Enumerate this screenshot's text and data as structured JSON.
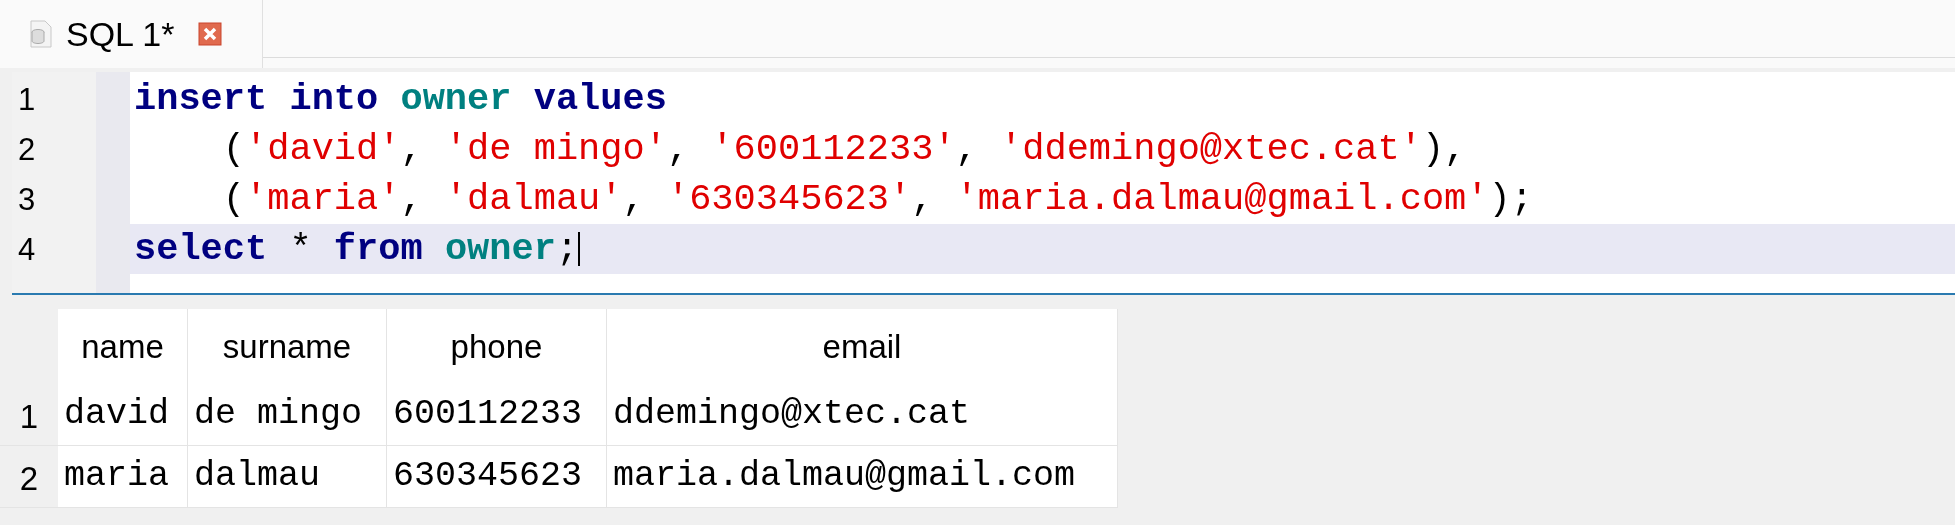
{
  "tab": {
    "label": "SQL 1*",
    "selected": true
  },
  "editor": {
    "lines": [
      {
        "number": "1",
        "current": false,
        "tokens": [
          {
            "text": "insert into ",
            "kind": "keyword"
          },
          {
            "text": "owner",
            "kind": "identifier"
          },
          {
            "text": " values",
            "kind": "keyword"
          }
        ]
      },
      {
        "number": "2",
        "current": false,
        "tokens": [
          {
            "text": "    (",
            "kind": "plain"
          },
          {
            "text": "'david'",
            "kind": "string"
          },
          {
            "text": ", ",
            "kind": "plain"
          },
          {
            "text": "'de mingo'",
            "kind": "string"
          },
          {
            "text": ", ",
            "kind": "plain"
          },
          {
            "text": "'600112233'",
            "kind": "string"
          },
          {
            "text": ", ",
            "kind": "plain"
          },
          {
            "text": "'ddemingo@xtec.cat'",
            "kind": "string"
          },
          {
            "text": "),",
            "kind": "plain"
          }
        ]
      },
      {
        "number": "3",
        "current": false,
        "tokens": [
          {
            "text": "    (",
            "kind": "plain"
          },
          {
            "text": "'maria'",
            "kind": "string"
          },
          {
            "text": ", ",
            "kind": "plain"
          },
          {
            "text": "'dalmau'",
            "kind": "string"
          },
          {
            "text": ", ",
            "kind": "plain"
          },
          {
            "text": "'630345623'",
            "kind": "string"
          },
          {
            "text": ", ",
            "kind": "plain"
          },
          {
            "text": "'maria.dalmau@gmail.com'",
            "kind": "string"
          },
          {
            "text": ");",
            "kind": "plain"
          }
        ]
      },
      {
        "number": "4",
        "current": true,
        "tokens": [
          {
            "text": "select",
            "kind": "keyword"
          },
          {
            "text": " * ",
            "kind": "plain"
          },
          {
            "text": "from ",
            "kind": "keyword"
          },
          {
            "text": "owner",
            "kind": "identifier"
          },
          {
            "text": ";",
            "kind": "plain"
          }
        ]
      }
    ]
  },
  "results": {
    "columns": [
      "name",
      "surname",
      "phone",
      "email"
    ],
    "rows": [
      {
        "number": "1",
        "cells": [
          "david",
          "de mingo",
          "600112233",
          "ddemingo@xtec.cat"
        ]
      },
      {
        "number": "2",
        "cells": [
          "maria",
          "dalmau",
          "630345623",
          "maria.dalmau@gmail.com"
        ]
      }
    ]
  }
}
